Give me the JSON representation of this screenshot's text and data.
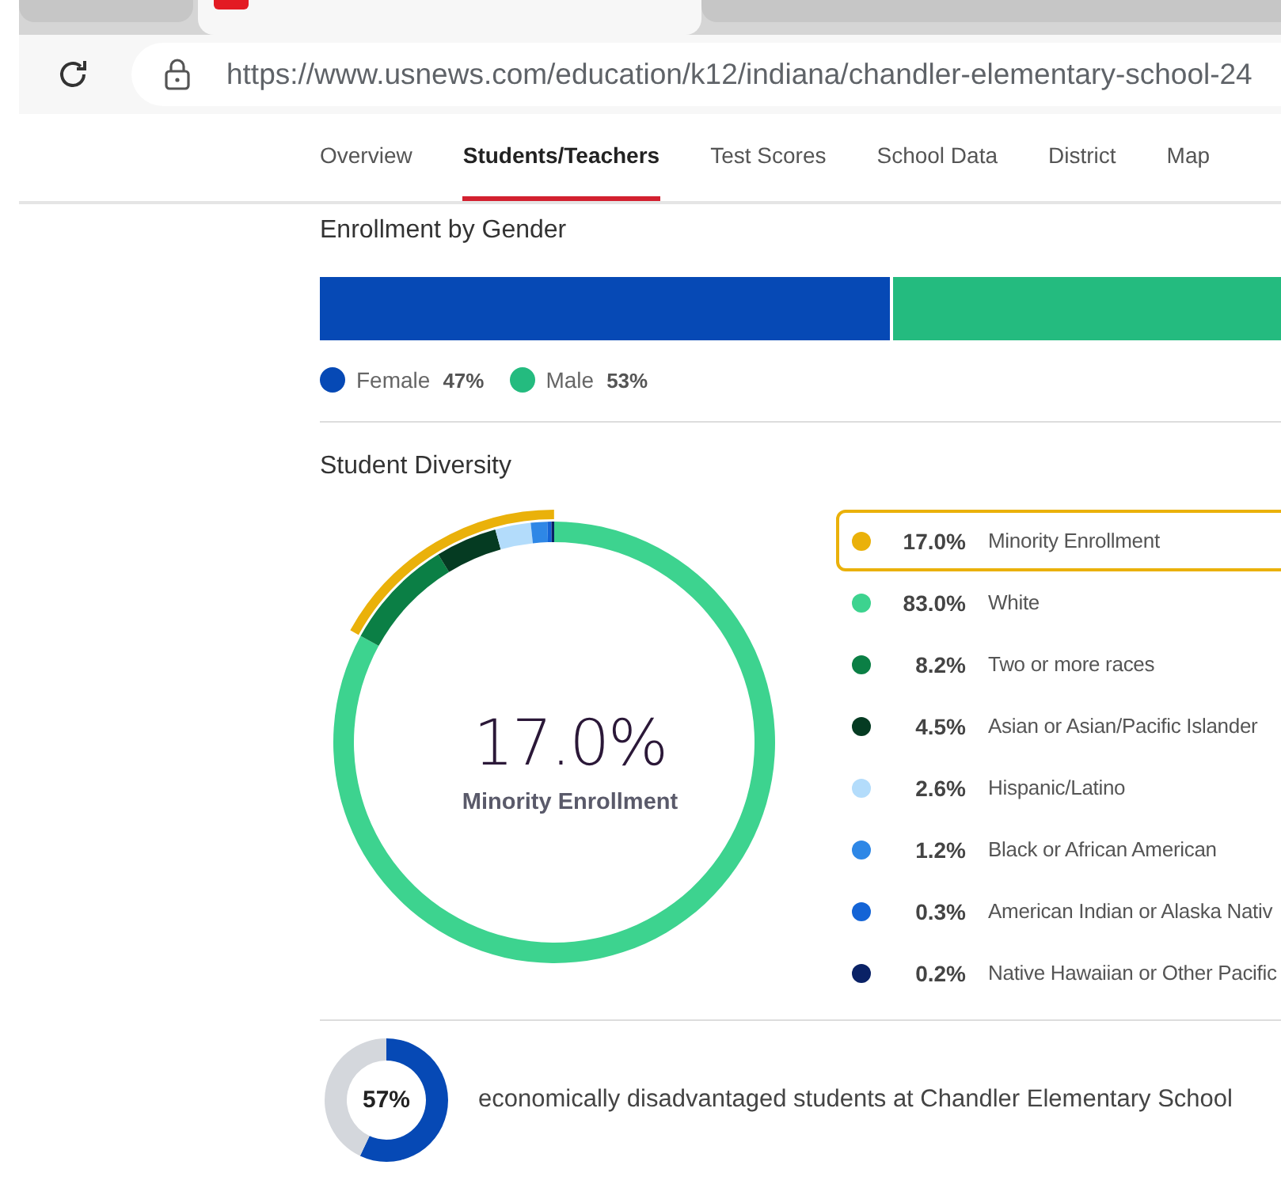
{
  "browser": {
    "tabs": [
      {
        "selected": false
      },
      {
        "selected": true
      },
      {
        "selected": false
      }
    ],
    "url": "https://www.usnews.com/education/k12/indiana/chandler-elementary-school-24"
  },
  "nav_tabs": [
    {
      "label": "Overview",
      "selected": false
    },
    {
      "label": "Students/Teachers",
      "selected": true
    },
    {
      "label": "Test Scores",
      "selected": false
    },
    {
      "label": "School Data",
      "selected": false
    },
    {
      "label": "District",
      "selected": false
    },
    {
      "label": "Map",
      "selected": false
    }
  ],
  "gender": {
    "title": "Enrollment by Gender",
    "level": 0.47,
    "items": [
      {
        "label": "Female",
        "value": "47%",
        "color": "#0649b5"
      },
      {
        "label": "Male",
        "value": "53%",
        "color": "#24bb7f"
      }
    ]
  },
  "diversity": {
    "title": "Student Diversity",
    "center_value": "17.0%",
    "center_label": "Minority Enrollment",
    "legend": [
      {
        "value": "17.0%",
        "label": "Minority Enrollment",
        "color": "#eab10a",
        "selected": true
      },
      {
        "value": "83.0%",
        "color": "#3dd38f",
        "selected": false
      },
      {
        "value": "8.2%",
        "color": "#0b7f45",
        "selected": false
      },
      {
        "value": "4.5%",
        "color": "#053b22",
        "selected": false
      },
      {
        "value": "2.6%",
        "color": "#b3dcfb",
        "selected": false
      },
      {
        "value": "1.2%",
        "color": "#2e87e6",
        "selected": false
      },
      {
        "value": "0.3%",
        "color": "#1464d6",
        "selected": false
      },
      {
        "value": "0.2%",
        "color": "#0a2266",
        "selected": false
      }
    ],
    "chart_data": {
      "type": "donut",
      "categories": [
        "White",
        "Two or more races",
        "Asian or Asian/Pacific Islander",
        "Hispanic/Latino",
        "Black or African American",
        "American Indian or Alaska Nativ",
        "Native Hawaiian or Other Pacific"
      ],
      "values": [
        83.0,
        8.2,
        4.5,
        2.6,
        1.2,
        0.3,
        0.2
      ]
    }
  },
  "economic": {
    "value": "57%",
    "chart_data": {
      "type": "donut",
      "values": [
        57,
        43
      ]
    },
    "text": "economically disadvantaged students at Chandler Elementary School"
  }
}
